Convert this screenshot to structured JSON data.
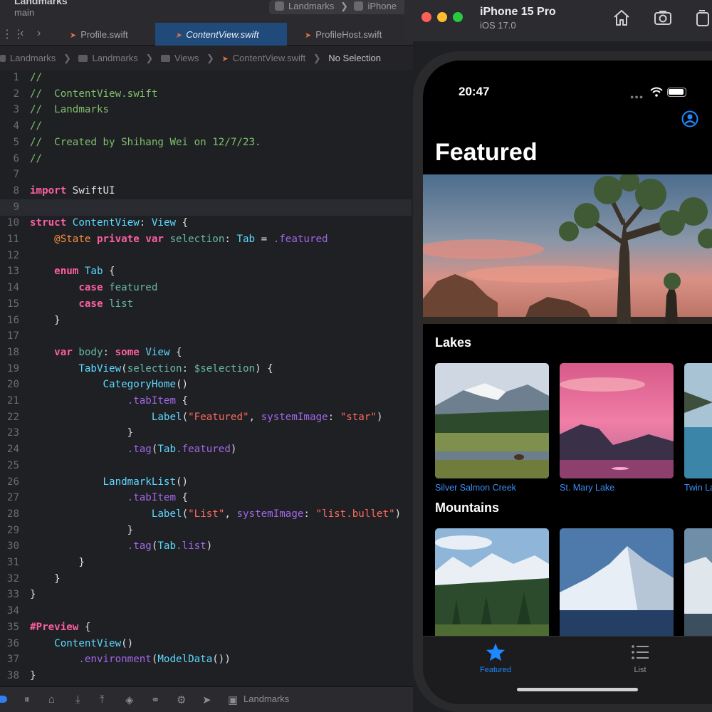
{
  "xcode": {
    "project_name": "Landmarks",
    "branch": "main",
    "scheme": "Landmarks",
    "destination": "iPhone",
    "tabs": [
      "Profile.swift",
      "ContentView.swift",
      "ProfileHost.swift"
    ],
    "breadcrumb": [
      "Landmarks",
      "Landmarks",
      "Views",
      "ContentView.swift",
      "No Selection"
    ],
    "status_scheme": "Landmarks",
    "line_numbers": [
      "1",
      "2",
      "3",
      "4",
      "5",
      "6",
      "7",
      "8",
      "9",
      "10",
      "11",
      "12",
      "13",
      "14",
      "15",
      "16",
      "17",
      "18",
      "19",
      "20",
      "21",
      "22",
      "23",
      "24",
      "25",
      "26",
      "27",
      "28",
      "29",
      "30",
      "31",
      "32",
      "33",
      "34",
      "35",
      "36",
      "37",
      "38"
    ],
    "code_lines": [
      "//",
      "//  ContentView.swift",
      "//  Landmarks",
      "//",
      "//  Created by Shihang Wei on 12/7/23.",
      "//",
      "",
      "import SwiftUI",
      "",
      "struct ContentView: View {",
      "    @State private var selection: Tab = .featured",
      "",
      "    enum Tab {",
      "        case featured",
      "        case list",
      "    }",
      "",
      "    var body: some View {",
      "        TabView(selection: $selection) {",
      "            CategoryHome()",
      "                .tabItem {",
      "                    Label(\"Featured\", systemImage: \"star\")",
      "                }",
      "                .tag(Tab.featured)",
      "",
      "            LandmarkList()",
      "                .tabItem {",
      "                    Label(\"List\", systemImage: \"list.bullet\")",
      "                }",
      "                .tag(Tab.list)",
      "        }",
      "    }",
      "}",
      "",
      "#Preview {",
      "    ContentView()",
      "        .environment(ModelData())",
      "}"
    ],
    "current_line": 9
  },
  "simulator": {
    "device_name": "iPhone 15 Pro",
    "os_version": "iOS 17.0",
    "icons": [
      "home-icon",
      "screenshot-icon",
      "rotate-icon"
    ]
  },
  "app": {
    "time": "20:47",
    "nav_title": "Featured",
    "categories": [
      {
        "title": "Lakes",
        "items": [
          "Silver Salmon Creek",
          "St. Mary Lake",
          "Twin Lake"
        ]
      },
      {
        "title": "Mountains",
        "items": [
          "",
          "",
          ""
        ]
      }
    ],
    "tabs": [
      {
        "label": "Featured",
        "icon": "star-icon",
        "selected": true
      },
      {
        "label": "List",
        "icon": "list-bullet-icon",
        "selected": false
      }
    ],
    "colors": {
      "accent": "#1e88ff",
      "link": "#3a8ef6",
      "traffic_red": "#fe5f57",
      "traffic_yellow": "#febc2e",
      "traffic_green": "#28c840"
    }
  }
}
